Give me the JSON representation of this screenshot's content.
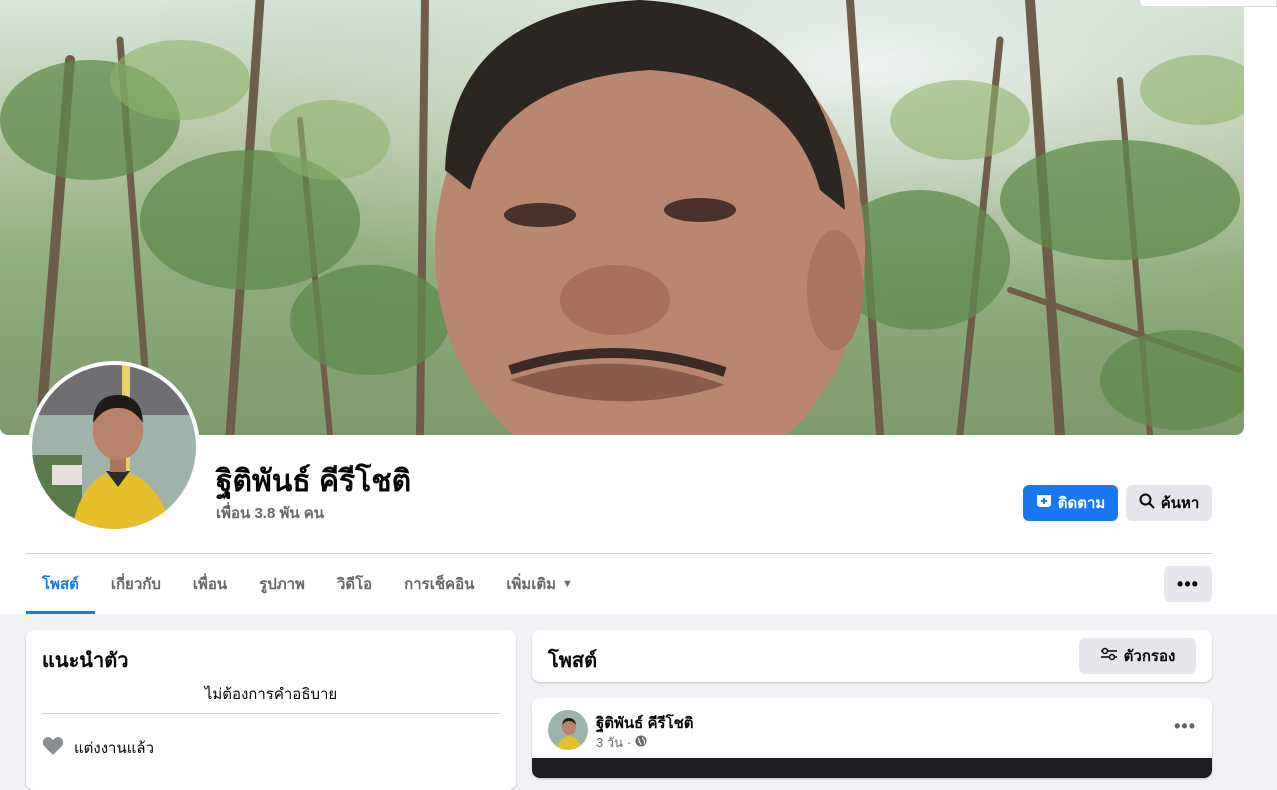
{
  "profile": {
    "name": "ฐิติพันธ์ คีรีโชติ",
    "friends": "เพื่อน 3.8 พัน คน"
  },
  "actions": {
    "follow": "ติดตาม",
    "search": "ค้นหา",
    "more": "•••"
  },
  "tabs": [
    {
      "label": "โพสต์",
      "active": true
    },
    {
      "label": "เกี่ยวกับ"
    },
    {
      "label": "เพื่อน"
    },
    {
      "label": "รูปภาพ"
    },
    {
      "label": "วิดีโอ"
    },
    {
      "label": "การเช็คอิน"
    },
    {
      "label": "เพิ่มเติม"
    }
  ],
  "intro": {
    "title": "แนะนำตัว",
    "bio": "ไม่ต้องการคำอธิบาย",
    "relationship": "แต่งงานแล้ว"
  },
  "posts": {
    "title": "โพสต์",
    "filter": "ตัวกรอง",
    "first": {
      "author": "ฐิติพันธ์ คีรีโชติ",
      "time": "3 วัน",
      "dots": "•••"
    }
  },
  "colors": {
    "accent": "#1877f2",
    "background": "#f0f2f5",
    "secondary_button": "#e4e6eb"
  }
}
